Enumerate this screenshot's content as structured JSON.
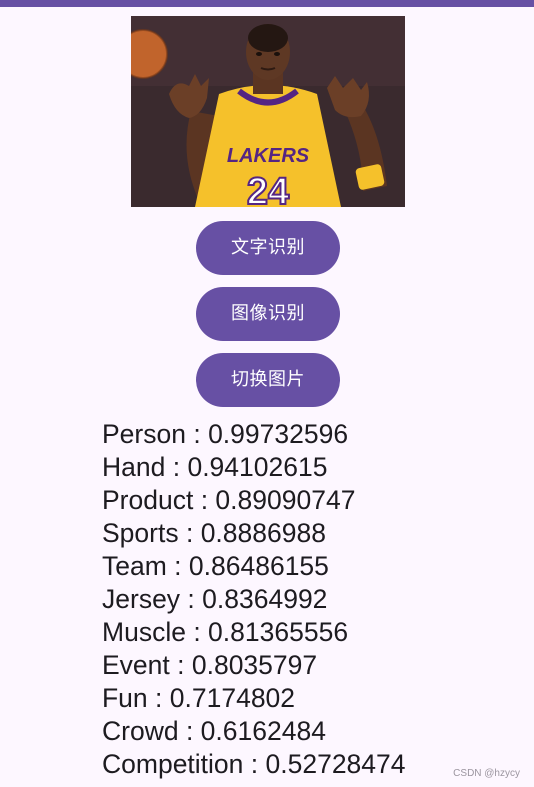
{
  "buttons": {
    "text_recognition": "文字识别",
    "image_recognition": "图像识别",
    "switch_image": "切换图片"
  },
  "photo": {
    "jersey_text": "LAKERS",
    "jersey_number": "24"
  },
  "results": [
    {
      "label": "Person",
      "score": "0.99732596"
    },
    {
      "label": "Hand",
      "score": "0.94102615"
    },
    {
      "label": "Product",
      "score": "0.89090747"
    },
    {
      "label": "Sports",
      "score": "0.8886988"
    },
    {
      "label": "Team",
      "score": "0.86486155"
    },
    {
      "label": "Jersey",
      "score": "0.8364992"
    },
    {
      "label": "Muscle",
      "score": "0.81365556"
    },
    {
      "label": "Event",
      "score": "0.8035797"
    },
    {
      "label": "Fun",
      "score": "0.7174802"
    },
    {
      "label": "Crowd",
      "score": "0.6162484"
    },
    {
      "label": "Competition",
      "score": "0.52728474"
    }
  ],
  "watermark": "CSDN @hzycy",
  "colors": {
    "primary": "#6750a4",
    "background": "#fdf7ff",
    "jersey_yellow": "#f5c12b",
    "jersey_purple": "#552583"
  }
}
